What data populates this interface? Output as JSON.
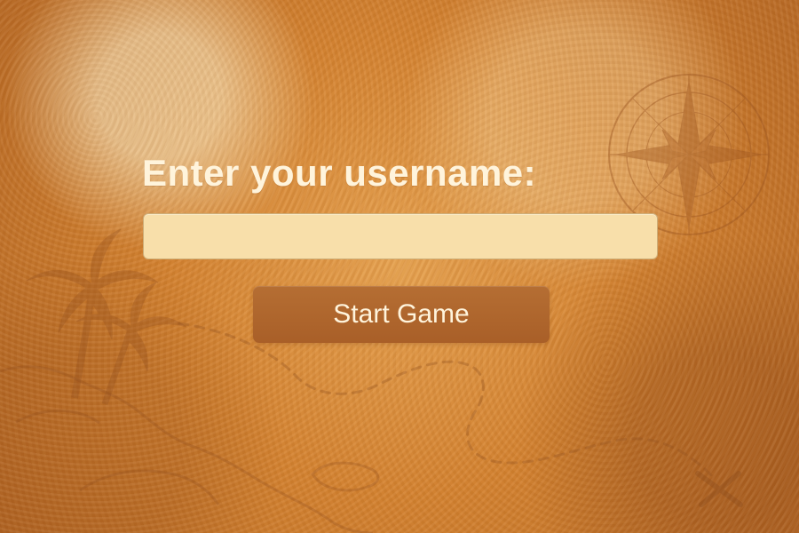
{
  "screen": {
    "title": "Enter your username:",
    "username_input": {
      "value": "",
      "placeholder": ""
    },
    "start_button_label": "Start Game"
  },
  "decorations": {
    "compass_icon": "compass-rose",
    "palm_trees_icon": "palm-trees",
    "map_path_icon": "dashed-map-path",
    "x_mark_icon": "treasure-x-mark",
    "island_icon": "island-outline"
  },
  "colors": {
    "background": "#d4822f",
    "text": "#fff4dc",
    "input_fill": "#f8dfaa",
    "button_fill": "#a95f28"
  }
}
